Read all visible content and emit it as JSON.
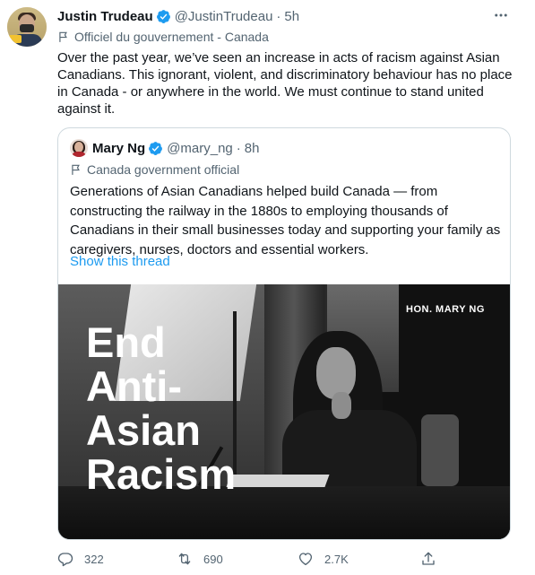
{
  "author": {
    "name": "Justin Trudeau",
    "handle": "@JustinTrudeau",
    "time": "5h",
    "dot": "·",
    "label": "Officiel du gouvernement - Canada"
  },
  "tweet": {
    "lines": [
      "Over the past year, we’ve seen an increase in acts of racism against Asian",
      "Canadians. This ignorant, violent, and discriminatory behaviour has no place",
      "in Canada - or anywhere in the world. We must continue to stand united",
      "against it."
    ]
  },
  "quote": {
    "name": "Mary Ng",
    "handle": "@mary_ng",
    "dot": "·",
    "time": "8h",
    "label": "Canada government official",
    "lines": [
      "Generations of Asian Canadians helped build Canada — from",
      "constructing the railway in the 1880s to employing thousands of",
      "Canadians in their small businesses today and supporting your family as",
      "caregivers, nurses, doctors and essential workers."
    ],
    "show_thread": "Show this thread",
    "image": {
      "title_lines": [
        "End",
        "Anti-",
        "Asian",
        "Racism"
      ],
      "caption": "HON. MARY NG"
    }
  },
  "actions": {
    "replies": "322",
    "retweets": "690",
    "likes": "2.7K"
  },
  "colors": {
    "text": "#0f1419",
    "secondary": "#536471",
    "link": "#1d9bf0",
    "verified": "#1d9bf0",
    "border": "#cfd9de"
  }
}
